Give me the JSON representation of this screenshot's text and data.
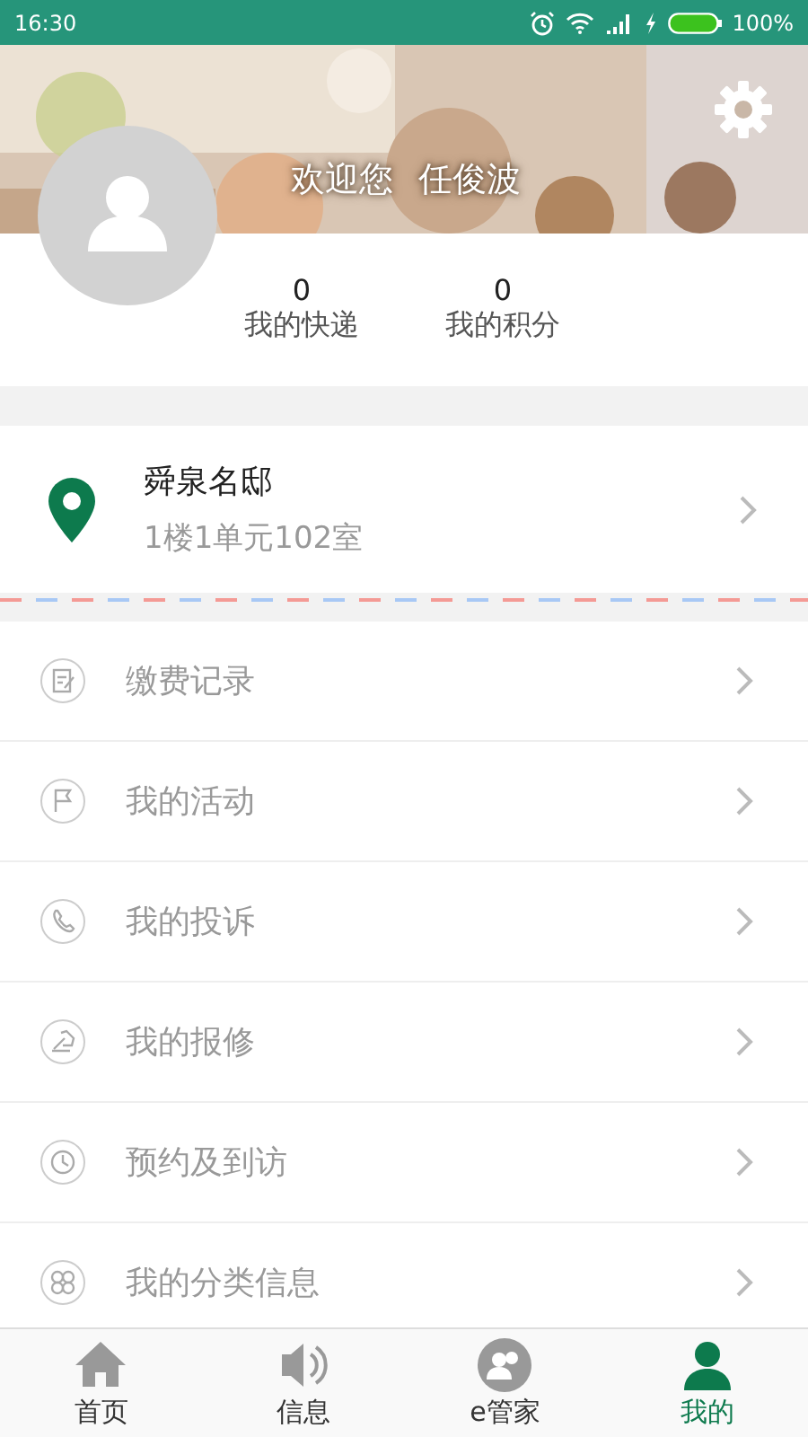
{
  "status_bar": {
    "time": "16:30",
    "battery": "100%"
  },
  "profile": {
    "greeting": "欢迎您",
    "name": "任俊波",
    "stats": [
      {
        "value": "0",
        "label": "我的快递"
      },
      {
        "value": "0",
        "label": "我的积分"
      }
    ]
  },
  "address": {
    "title": "舜泉名邸",
    "detail": "1楼1单元102室"
  },
  "menu": [
    {
      "kind": "bill",
      "label": "缴费记录"
    },
    {
      "kind": "flag",
      "label": "我的活动"
    },
    {
      "kind": "phone",
      "label": "我的投诉"
    },
    {
      "kind": "repair",
      "label": "我的报修"
    },
    {
      "kind": "clock",
      "label": "预约及到访"
    },
    {
      "kind": "category",
      "label": "我的分类信息"
    }
  ],
  "tabs": [
    {
      "kind": "home",
      "label": "首页",
      "selected": false
    },
    {
      "kind": "speaker",
      "label": "信息",
      "selected": false
    },
    {
      "kind": "butler",
      "label": "e管家",
      "selected": false
    },
    {
      "kind": "me",
      "label": "我的",
      "selected": true
    }
  ]
}
